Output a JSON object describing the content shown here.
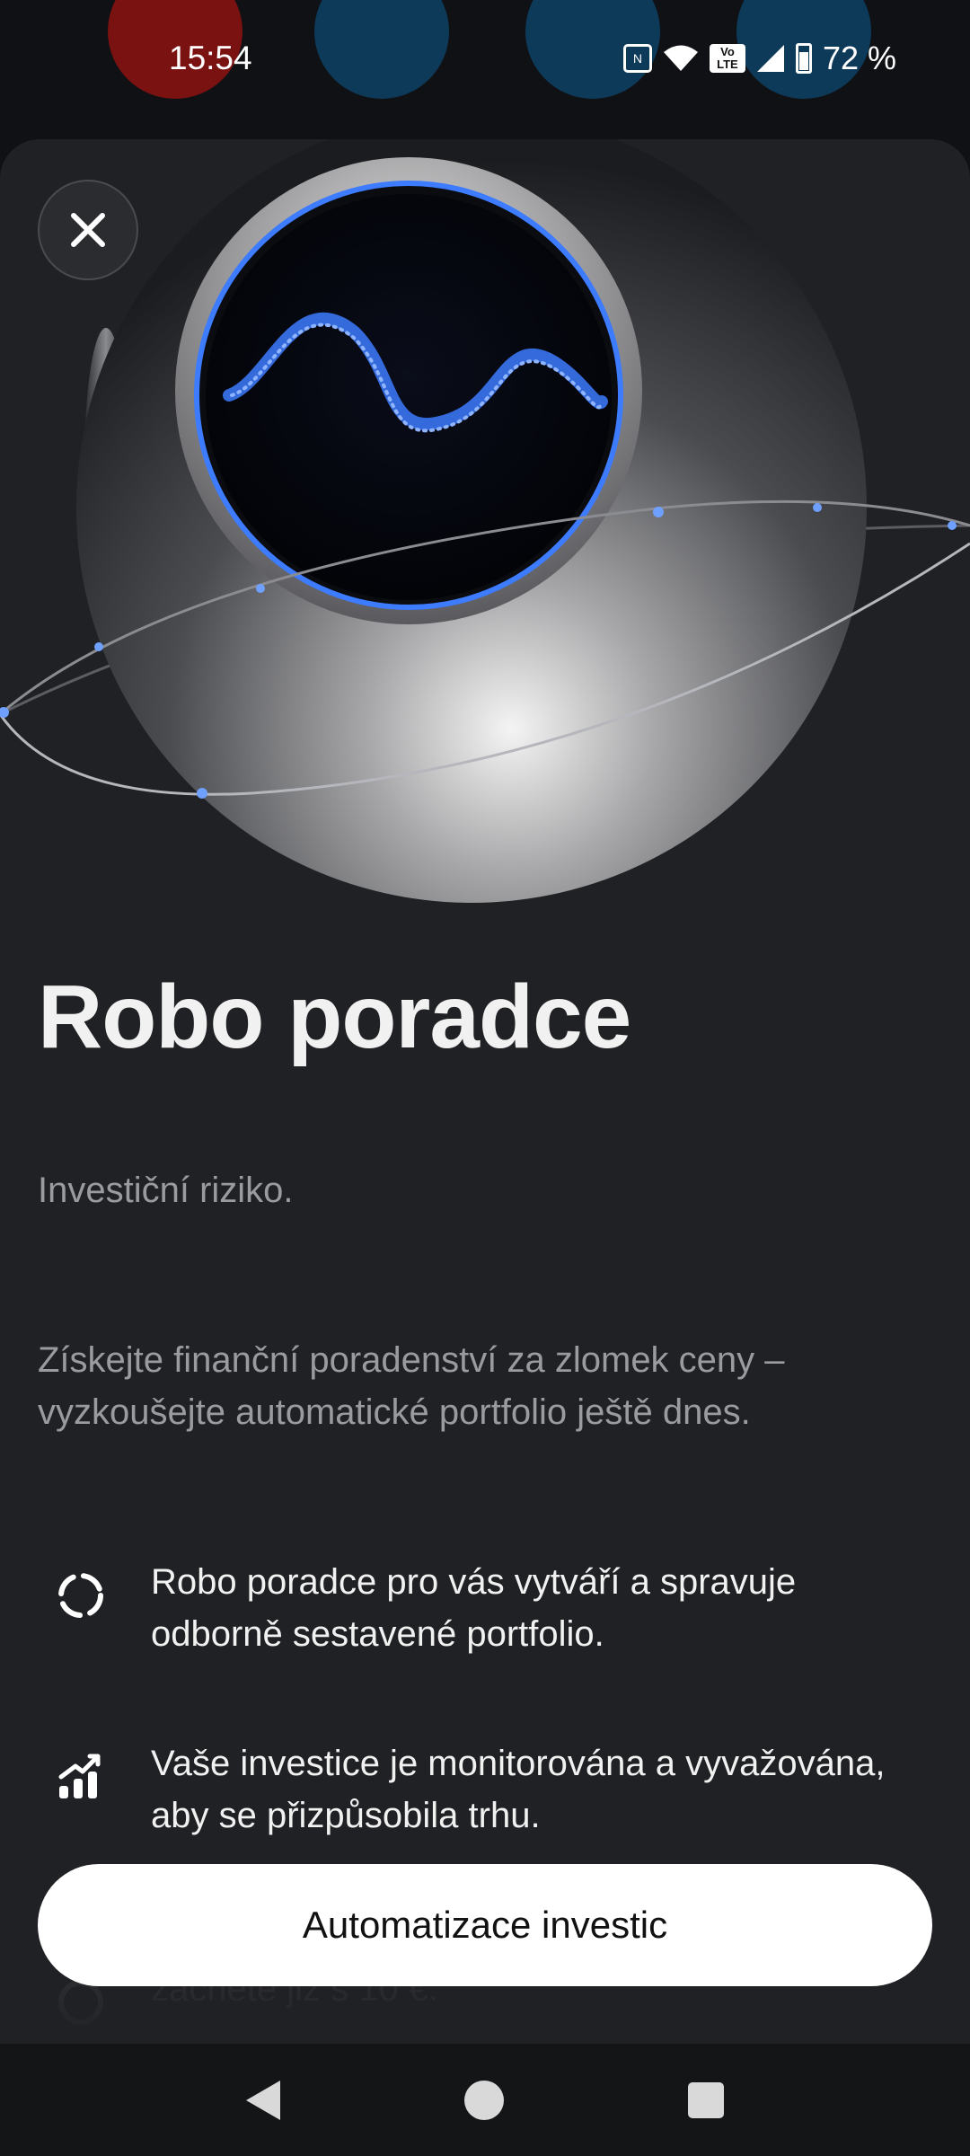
{
  "status_bar": {
    "time": "15:54",
    "battery": "72 %",
    "icons": [
      "nfc-icon",
      "wifi-icon",
      "volte-icon",
      "signal-icon",
      "battery-icon"
    ],
    "volte_label": "Vo LTE"
  },
  "sheet": {
    "close_icon": "close-icon",
    "hero_icon": "robo-sphere-illustration",
    "title": "Robo poradce",
    "subtitle": "Investiční riziko.",
    "lead": "Získejte finanční poradenství za zlomek ceny – vyzkoušejte automatické portfolio ještě dnes.",
    "features": [
      {
        "icon": "loading-ring-icon",
        "text": "Robo poradce pro vás vytváří a spravuje odborně sestavené portfolio."
      },
      {
        "icon": "chart-growth-icon",
        "text": "Vaše investice je monitorována a vyvažována, aby se přizpůsobila trhu."
      },
      {
        "icon": "coin-icon",
        "text": "začněte již s 10 €."
      }
    ],
    "cta_label": "Automatizace investic"
  },
  "nav_bar": {
    "icons": [
      "back-icon",
      "home-icon",
      "recents-icon"
    ]
  },
  "colors": {
    "background": "#202124",
    "text_primary": "#f1f1f1",
    "text_secondary": "#9a9b9f",
    "cta_bg": "#ffffff",
    "accent_glow": "#3d7bff"
  }
}
